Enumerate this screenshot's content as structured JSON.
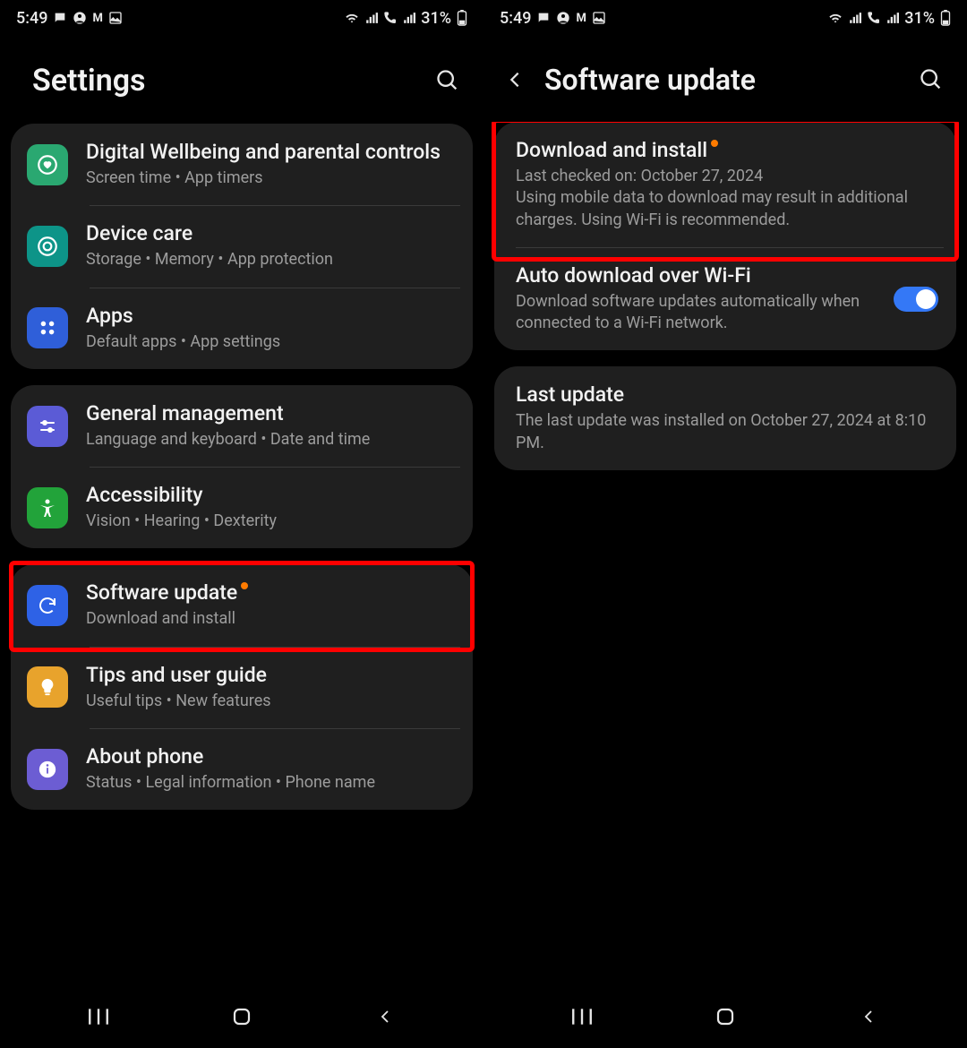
{
  "status": {
    "time": "5:49",
    "battery": "31%"
  },
  "left": {
    "title": "Settings",
    "groups": [
      {
        "rows": [
          {
            "title": "Digital Wellbeing and parental controls",
            "sub": "Screen time  •  App timers"
          },
          {
            "title": "Device care",
            "sub": "Storage  •  Memory  •  App protection"
          },
          {
            "title": "Apps",
            "sub": "Default apps  •  App settings"
          }
        ]
      },
      {
        "rows": [
          {
            "title": "General management",
            "sub": "Language and keyboard  •  Date and time"
          },
          {
            "title": "Accessibility",
            "sub": "Vision  •  Hearing  •  Dexterity"
          }
        ]
      },
      {
        "rows": [
          {
            "title": "Software update",
            "sub": "Download and install"
          },
          {
            "title": "Tips and user guide",
            "sub": "Useful tips  •  New features"
          },
          {
            "title": "About phone",
            "sub": "Status  •  Legal information  •  Phone name"
          }
        ]
      }
    ]
  },
  "right": {
    "title": "Software update",
    "rows": [
      {
        "title": "Download and install",
        "sub": "Last checked on: October 27, 2024\nUsing mobile data to download may result in additional charges. Using Wi-Fi is recommended."
      },
      {
        "title": "Auto download over Wi-Fi",
        "sub": "Download software updates automatically when connected to a Wi-Fi network.",
        "toggle": true
      },
      {
        "title": "Last update",
        "sub": "The last update was installed on October 27, 2024 at 8:10 PM."
      }
    ]
  }
}
